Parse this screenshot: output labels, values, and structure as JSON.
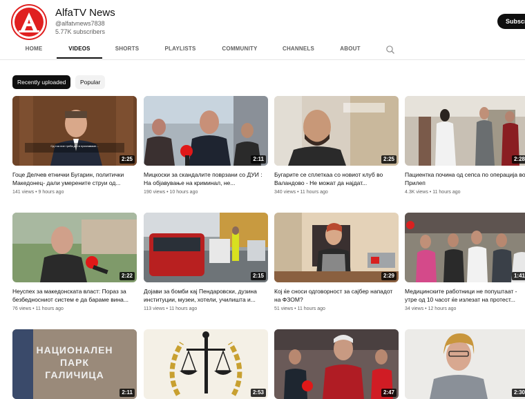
{
  "channel": {
    "name": "AlfaTV News",
    "handle": "@alfatvnews7838",
    "subscribers": "5.77K subscribers",
    "subscribe_label": "Subscribe",
    "brand_color": "#e02020"
  },
  "tabs": [
    {
      "label": "HOME",
      "active": false
    },
    {
      "label": "VIDEOS",
      "active": true
    },
    {
      "label": "SHORTS",
      "active": false
    },
    {
      "label": "PLAYLISTS",
      "active": false
    },
    {
      "label": "COMMUNITY",
      "active": false
    },
    {
      "label": "CHANNELS",
      "active": false
    },
    {
      "label": "ABOUT",
      "active": false
    }
  ],
  "search_icon": "search-icon",
  "chips": [
    {
      "label": "Recently uploaded",
      "active": true
    },
    {
      "label": "Popular",
      "active": false
    }
  ],
  "videos": [
    {
      "title": "Гоце Делчев етнички Бугарин, политички Македонец- дали умерените струи од...",
      "views": "141 views",
      "age": "9 hours ago",
      "duration": "2:25",
      "caption": "Од тоа ние треба да ги признаваме..."
    },
    {
      "title": "Мицкоски за скандалите поврзани со ДУИ : На објавување на криминал, не...",
      "views": "190 views",
      "age": "10 hours ago",
      "duration": "2:11"
    },
    {
      "title": "Бугарите се сплеткаа со новиот клуб во Валандово - Не можат да најдат...",
      "views": "340 views",
      "age": "11 hours ago",
      "duration": "2:25"
    },
    {
      "title": "Пациентка почина од сепса по операција во Прилеп",
      "views": "4.3K views",
      "age": "11 hours ago",
      "duration": "2:28"
    },
    {
      "title": "Неуспех за македонската власт: Пораз за безбедносниот систем е да бараме вина...",
      "views": "76 views",
      "age": "11 hours ago",
      "duration": "2:22"
    },
    {
      "title": "Дојави за бомби кај Пендаровски, дузина институции, музеи, хотели, училишта и...",
      "views": "113 views",
      "age": "11 hours ago",
      "duration": "2:15"
    },
    {
      "title": "Кој ќе сноси одговорност за сајбер нападот на ФЗОМ?",
      "views": "51 views",
      "age": "11 hours ago",
      "duration": "2:29"
    },
    {
      "title": "Медицинските работници не попуштаат - утре од 10 часот ќе излезат на протест...",
      "views": "34 views",
      "age": "12 hours ago",
      "duration": "1:41"
    },
    {
      "title": "",
      "views": "",
      "age": "",
      "duration": "2:11",
      "sign_text": "НАЦИОНАЛЕН ПАРК ГАЛИЧИЦА"
    },
    {
      "title": "",
      "views": "",
      "age": "",
      "duration": "2:53"
    },
    {
      "title": "",
      "views": "",
      "age": "",
      "duration": "2:47"
    },
    {
      "title": "",
      "views": "",
      "age": "",
      "duration": "2:30"
    }
  ]
}
